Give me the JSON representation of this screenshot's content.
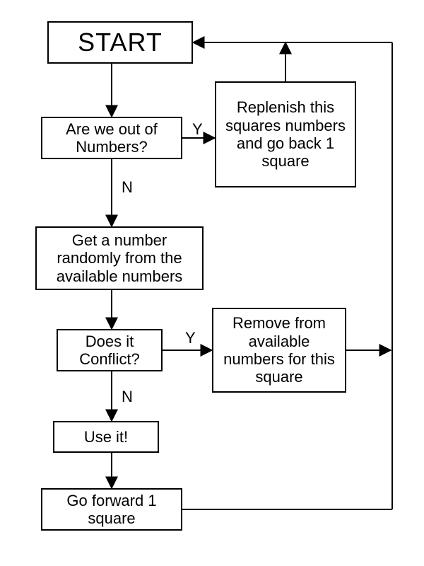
{
  "nodes": {
    "start": "START",
    "out_of_numbers": "Are we out of Numbers?",
    "replenish": "Replenish this squares numbers and go back 1 square",
    "get_number": "Get a number randomly from the available numbers",
    "conflict": "Does it Conflict?",
    "remove": "Remove from available numbers for this square",
    "use_it": "Use it!",
    "go_forward": "Go forward 1 square"
  },
  "labels": {
    "yes": "Y",
    "no": "N"
  },
  "chart_data": {
    "type": "flowchart",
    "title": "",
    "nodes": [
      {
        "id": "start",
        "kind": "terminator",
        "text": "START"
      },
      {
        "id": "outnum",
        "kind": "decision",
        "text": "Are we out of Numbers?"
      },
      {
        "id": "replenish",
        "kind": "process",
        "text": "Replenish this squares numbers and go back 1 square"
      },
      {
        "id": "getnum",
        "kind": "process",
        "text": "Get a number randomly from the available numbers"
      },
      {
        "id": "conflict",
        "kind": "decision",
        "text": "Does it Conflict?"
      },
      {
        "id": "remove",
        "kind": "process",
        "text": "Remove from available numbers for this square"
      },
      {
        "id": "useit",
        "kind": "process",
        "text": "Use it!"
      },
      {
        "id": "forward",
        "kind": "process",
        "text": "Go forward 1 square"
      }
    ],
    "edges": [
      {
        "from": "start",
        "to": "outnum",
        "label": ""
      },
      {
        "from": "outnum",
        "to": "replenish",
        "label": "Y"
      },
      {
        "from": "outnum",
        "to": "getnum",
        "label": "N"
      },
      {
        "from": "replenish",
        "to": "start",
        "label": ""
      },
      {
        "from": "getnum",
        "to": "conflict",
        "label": ""
      },
      {
        "from": "conflict",
        "to": "remove",
        "label": "Y"
      },
      {
        "from": "conflict",
        "to": "useit",
        "label": "N"
      },
      {
        "from": "remove",
        "to": "start",
        "label": ""
      },
      {
        "from": "useit",
        "to": "forward",
        "label": ""
      },
      {
        "from": "forward",
        "to": "start",
        "label": ""
      }
    ]
  }
}
